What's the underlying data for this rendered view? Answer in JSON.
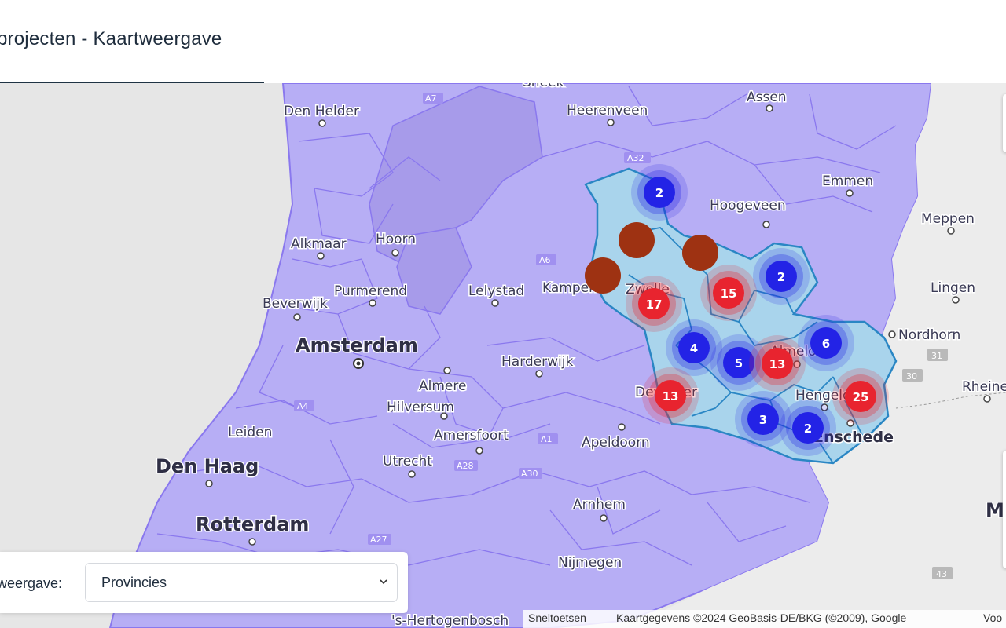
{
  "page": {
    "title": "projecten - Kaartweergave"
  },
  "map": {
    "cities": [
      {
        "name": "Den Helder"
      },
      {
        "name": "Heerenveen"
      },
      {
        "name": "Assen"
      },
      {
        "name": "Emmen"
      },
      {
        "name": "Hoogeveen"
      },
      {
        "name": "Meppen"
      },
      {
        "name": "Lingen"
      },
      {
        "name": "Nordhorn"
      },
      {
        "name": "Rheine"
      },
      {
        "name": "Alkmaar"
      },
      {
        "name": "Hoorn"
      },
      {
        "name": "Purmerend"
      },
      {
        "name": "Lelystad"
      },
      {
        "name": "Kampen"
      },
      {
        "name": "Zwolle"
      },
      {
        "name": "Beverwijk"
      },
      {
        "name": "Amsterdam"
      },
      {
        "name": "Harderwijk"
      },
      {
        "name": "Almere"
      },
      {
        "name": "Hilversum"
      },
      {
        "name": "Almelo"
      },
      {
        "name": "Hengelo"
      },
      {
        "name": "Enschede"
      },
      {
        "name": "Deventer"
      },
      {
        "name": "Leiden"
      },
      {
        "name": "Amersfoort"
      },
      {
        "name": "Apeldoorn"
      },
      {
        "name": "Utrecht"
      },
      {
        "name": "Den Haag"
      },
      {
        "name": "Arnhem"
      },
      {
        "name": "Rotterdam"
      },
      {
        "name": "Nijmegen"
      },
      {
        "name": "'s-Hertogenbosch"
      },
      {
        "name": "Sneek"
      },
      {
        "name": "M"
      }
    ],
    "roads": [
      "A7",
      "A32",
      "A6",
      "A1",
      "A30",
      "A28",
      "A27",
      "A4",
      "31",
      "30",
      "43"
    ],
    "clusters": [
      {
        "count": "2",
        "color": "#2323e6",
        "type": "blue"
      },
      {
        "count": "2",
        "color": "#2323e6",
        "type": "blue"
      },
      {
        "count": "17",
        "color": "#e8242f",
        "type": "red"
      },
      {
        "count": "15",
        "color": "#e8242f",
        "type": "red"
      },
      {
        "count": "4",
        "color": "#2323e6",
        "type": "blue"
      },
      {
        "count": "5",
        "color": "#2323e6",
        "type": "blue"
      },
      {
        "count": "13",
        "color": "#e8242f",
        "type": "red"
      },
      {
        "count": "6",
        "color": "#2323e6",
        "type": "blue"
      },
      {
        "count": "13",
        "color": "#e8242f",
        "type": "red"
      },
      {
        "count": "25",
        "color": "#e8242f",
        "type": "red"
      },
      {
        "count": "3",
        "color": "#2323e6",
        "type": "blue"
      },
      {
        "count": "2",
        "color": "#2323e6",
        "type": "blue"
      }
    ],
    "markers": {
      "color": "#9e3212",
      "count": 3
    },
    "colors": {
      "province_fill": "#b7aef5",
      "region_stroke": "#8a78ee",
      "highlight_fill": "#a9d4ec",
      "highlight_stroke": "#2a86c4"
    }
  },
  "view": {
    "label": "weergave:",
    "selected": "Provincies"
  },
  "attribution": {
    "shortcuts": "Sneltoetsen",
    "data": "Kaartgegevens ©2024 GeoBasis-DE/BKG (©2009), Google",
    "more": "Voo"
  }
}
